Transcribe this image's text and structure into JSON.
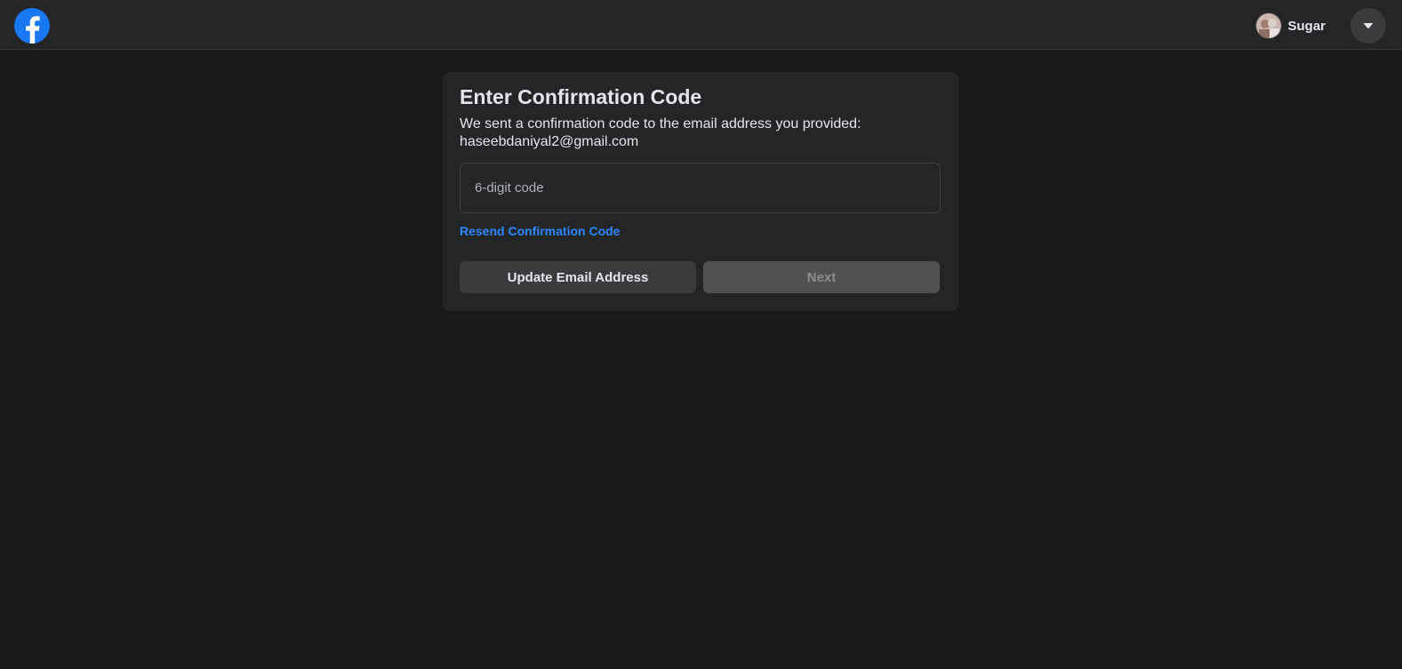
{
  "header": {
    "logo_icon": "facebook-logo-icon",
    "profile": {
      "name": "Sugar",
      "avatar_icon": "user-avatar"
    },
    "menu_icon": "caret-down-icon"
  },
  "card": {
    "title": "Enter Confirmation Code",
    "description_line1": "We sent a confirmation code to the email address you provided:",
    "email": "haseebdaniyal2@gmail.com",
    "code_input": {
      "value": "",
      "placeholder": "6-digit code"
    },
    "resend_link": "Resend Confirmation Code",
    "update_email_button": "Update Email Address",
    "next_button": "Next"
  },
  "colors": {
    "background": "#18191a",
    "surface": "#242526",
    "link": "#2d88ff",
    "brand": "#1877f2"
  }
}
